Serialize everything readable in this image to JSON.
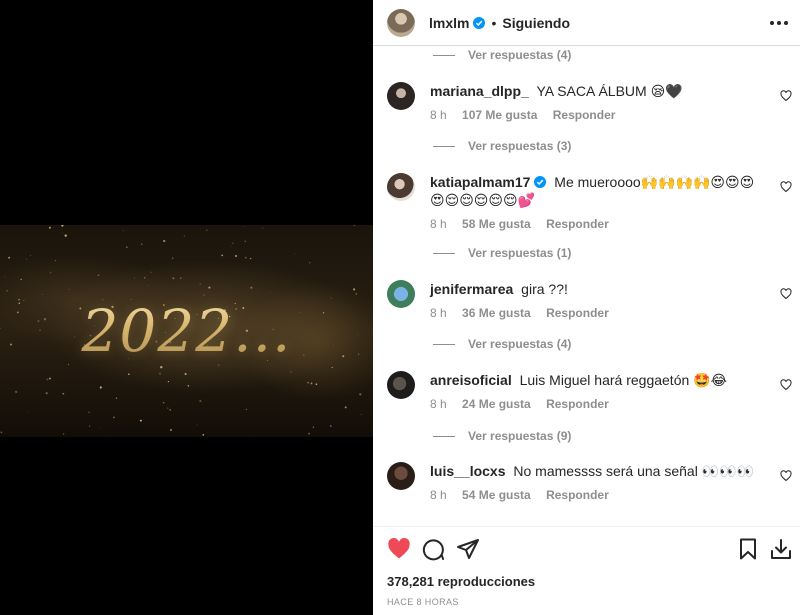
{
  "media": {
    "overlay_text": "2022..."
  },
  "header": {
    "username": "lmxlm",
    "separator": "•",
    "follow_status": "Siguiendo"
  },
  "comments": [
    {
      "type": "replies",
      "label": "Ver respuestas (4)"
    },
    {
      "type": "comment",
      "username": "mariana_dlpp_",
      "text": "YA SACA ÁLBUM 😪🖤",
      "time": "8 h",
      "likes": "107 Me gusta",
      "reply": "Responder"
    },
    {
      "type": "replies",
      "label": "Ver respuestas (3)"
    },
    {
      "type": "comment",
      "username": "katiapalmam17",
      "verified": true,
      "text": "Me mueroooo🙌🙌🙌🙌😍😍😍😍😌😌😌😌😌💕",
      "time": "8 h",
      "likes": "58 Me gusta",
      "reply": "Responder"
    },
    {
      "type": "replies",
      "label": "Ver respuestas (1)"
    },
    {
      "type": "comment",
      "username": "jenifermarea",
      "text": "gira ??!",
      "time": "8 h",
      "likes": "36 Me gusta",
      "reply": "Responder"
    },
    {
      "type": "replies",
      "label": "Ver respuestas (4)"
    },
    {
      "type": "comment",
      "username": "anreisoficial",
      "text": "Luis Miguel hará reggaetón 🤩😂",
      "time": "8 h",
      "likes": "24 Me gusta",
      "reply": "Responder"
    },
    {
      "type": "replies",
      "label": "Ver respuestas (9)"
    },
    {
      "type": "comment",
      "username": "luis__locxs",
      "text": "No mamessss será una señal 👀👀👀",
      "time": "8 h",
      "likes": "54 Me gusta",
      "reply": "Responder"
    }
  ],
  "footer": {
    "views": "378,281 reproducciones",
    "posted": "HACE 8 HORAS"
  },
  "colors": {
    "like_red": "#ed4956",
    "muted": "#8e8e8e",
    "verified_blue": "#0095f6"
  },
  "icons": [
    "heart-filled-icon",
    "comment-icon",
    "share-icon",
    "bookmark-icon",
    "download-icon",
    "more-icon",
    "verified-icon"
  ]
}
